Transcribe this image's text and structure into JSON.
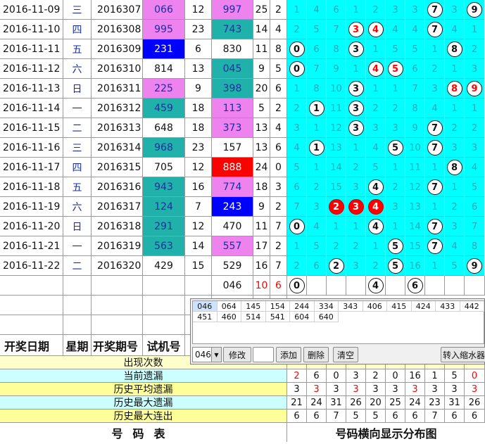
{
  "rows": [
    {
      "date": "2016-11-09",
      "week": "三",
      "issue": "2016307",
      "trial": "066",
      "trial_bg": "pink",
      "tsum": "12",
      "draw": "997",
      "draw_bg": "pink",
      "dsum": "25",
      "span": "2",
      "dist": [
        "1",
        "4",
        "6",
        "1",
        "2",
        "3",
        "3",
        "7",
        "3",
        "9"
      ],
      "balls": {
        "7": "w",
        "9": "w"
      }
    },
    {
      "date": "2016-11-10",
      "week": "四",
      "issue": "2016308",
      "trial": "995",
      "trial_bg": "pink",
      "tsum": "23",
      "draw": "743",
      "draw_bg": "teal",
      "dsum": "14",
      "span": "4",
      "dist": [
        "2",
        "5",
        "7",
        "3",
        "4",
        "4",
        "4",
        "7",
        "4",
        "1"
      ],
      "balls": {
        "3": "wr",
        "4": "wr",
        "7": "w"
      }
    },
    {
      "date": "2016-11-11",
      "week": "五",
      "issue": "2016309",
      "trial": "231",
      "trial_bg": "blue",
      "tsum": "6",
      "draw": "830",
      "draw_bg": "white",
      "dsum": "11",
      "span": "8",
      "dist": [
        "0",
        "6",
        "8",
        "3",
        "1",
        "5",
        "5",
        "1",
        "8",
        "2"
      ],
      "balls": {
        "0": "w",
        "3": "w",
        "8": "w"
      }
    },
    {
      "date": "2016-11-12",
      "week": "六",
      "issue": "2016310",
      "trial": "814",
      "trial_bg": "white",
      "tsum": "13",
      "draw": "045",
      "draw_bg": "teal",
      "dsum": "9",
      "span": "5",
      "dist": [
        "0",
        "7",
        "9",
        "1",
        "4",
        "5",
        "6",
        "2",
        "1",
        "3"
      ],
      "balls": {
        "0": "w",
        "4": "wr",
        "5": "wr"
      }
    },
    {
      "date": "2016-11-13",
      "week": "日",
      "issue": "2016311",
      "trial": "225",
      "trial_bg": "pink",
      "tsum": "9",
      "draw": "398",
      "draw_bg": "teal",
      "dsum": "20",
      "span": "6",
      "dist": [
        "1",
        "8",
        "10",
        "3",
        "1",
        "1",
        "7",
        "3",
        "8",
        "9"
      ],
      "balls": {
        "3": "w",
        "8": "wr",
        "9": "wr"
      }
    },
    {
      "date": "2016-11-14",
      "week": "一",
      "issue": "2016312",
      "trial": "459",
      "trial_bg": "teal",
      "tsum": "18",
      "draw": "113",
      "draw_bg": "pink",
      "dsum": "5",
      "span": "2",
      "dist": [
        "2",
        "1",
        "11",
        "3",
        "2",
        "2",
        "8",
        "4",
        "1",
        "1"
      ],
      "balls": {
        "1": "w",
        "3": "w"
      }
    },
    {
      "date": "2016-11-15",
      "week": "二",
      "issue": "2016313",
      "trial": "648",
      "trial_bg": "white",
      "tsum": "18",
      "draw": "373",
      "draw_bg": "pink",
      "dsum": "13",
      "span": "4",
      "dist": [
        "3",
        "1",
        "12",
        "3",
        "3",
        "3",
        "9",
        "7",
        "2",
        "2"
      ],
      "balls": {
        "3": "w",
        "7": "w"
      }
    },
    {
      "date": "2016-11-16",
      "week": "三",
      "issue": "2016314",
      "trial": "968",
      "trial_bg": "teal",
      "tsum": "23",
      "draw": "157",
      "draw_bg": "white",
      "dsum": "13",
      "span": "6",
      "dist": [
        "4",
        "1",
        "13",
        "1",
        "4",
        "5",
        "10",
        "7",
        "3",
        "3"
      ],
      "balls": {
        "1": "w",
        "5": "w",
        "7": "w"
      }
    },
    {
      "date": "2016-11-17",
      "week": "四",
      "issue": "2016315",
      "trial": "705",
      "trial_bg": "white",
      "tsum": "12",
      "draw": "888",
      "draw_bg": "red",
      "dsum": "24",
      "span": "0",
      "dist": [
        "5",
        "1",
        "14",
        "2",
        "5",
        "1",
        "11",
        "1",
        "8",
        "4"
      ],
      "balls": {
        "8": "w"
      }
    },
    {
      "date": "2016-11-18",
      "week": "五",
      "issue": "2016316",
      "trial": "943",
      "trial_bg": "teal",
      "tsum": "16",
      "draw": "774",
      "draw_bg": "pink",
      "dsum": "18",
      "span": "3",
      "dist": [
        "6",
        "2",
        "15",
        "3",
        "4",
        "2",
        "12",
        "7",
        "1",
        "5"
      ],
      "balls": {
        "4": "w",
        "7": "w"
      }
    },
    {
      "date": "2016-11-19",
      "week": "六",
      "issue": "2016317",
      "trial": "124",
      "trial_bg": "teal",
      "tsum": "7",
      "draw": "243",
      "draw_bg": "blue",
      "dsum": "9",
      "span": "2",
      "dist": [
        "7",
        "3",
        "2",
        "3",
        "4",
        "3",
        "13",
        "1",
        "2",
        "6"
      ],
      "balls": {
        "2": "r",
        "3": "r",
        "4": "r"
      }
    },
    {
      "date": "2016-11-20",
      "week": "日",
      "issue": "2016318",
      "trial": "291",
      "trial_bg": "teal",
      "tsum": "12",
      "draw": "470",
      "draw_bg": "white",
      "dsum": "11",
      "span": "7",
      "dist": [
        "0",
        "4",
        "1",
        "1",
        "4",
        "1",
        "14",
        "7",
        "3",
        "7"
      ],
      "balls": {
        "0": "w",
        "4": "w",
        "7": "w"
      }
    },
    {
      "date": "2016-11-21",
      "week": "一",
      "issue": "2016319",
      "trial": "563",
      "trial_bg": "teal",
      "tsum": "14",
      "draw": "557",
      "draw_bg": "pink",
      "dsum": "17",
      "span": "2",
      "dist": [
        "1",
        "5",
        "2",
        "2",
        "1",
        "5",
        "15",
        "7",
        "4",
        "8"
      ],
      "balls": {
        "5": "w",
        "7": "w"
      }
    },
    {
      "date": "2016-11-22",
      "week": "二",
      "issue": "2016320",
      "trial": "429",
      "trial_bg": "white",
      "tsum": "15",
      "draw": "529",
      "draw_bg": "white",
      "dsum": "16",
      "span": "7",
      "dist": [
        "2",
        "6",
        "2",
        "3",
        "2",
        "5",
        "16",
        "1",
        "5",
        "9"
      ],
      "balls": {
        "2": "w",
        "5": "w",
        "9": "w"
      }
    }
  ],
  "forecast_row": {
    "draw": "046",
    "dsum": "10",
    "span": "6",
    "dist": [
      "0",
      "",
      "",
      "",
      "4",
      "",
      "6",
      "",
      "",
      ""
    ],
    "balls": {
      "0": "w",
      "4": "w",
      "6": "w"
    }
  },
  "header": {
    "date": "开奖日期",
    "week": "星期",
    "issue": "开奖期号",
    "trial": "试机号",
    "tsum": "试",
    "draw": "",
    "dsum": "",
    "span": ""
  },
  "panel": {
    "combos": [
      "046",
      "064",
      "145",
      "154",
      "244",
      "334",
      "343",
      "406",
      "415",
      "424",
      "433",
      "442",
      "451",
      "460",
      "514",
      "541",
      "604",
      "640"
    ],
    "select_value": "046",
    "btn_modify": "修改",
    "input_value": "",
    "btn_add": "添加",
    "btn_delete": "删除",
    "btn_clear": "清空",
    "btn_transfer": "转入缩水器"
  },
  "stats": [
    {
      "label": "出现次数",
      "values": [
        "",
        "",
        "",
        "",
        "",
        "",
        "",
        "",
        "",
        ""
      ],
      "red": []
    },
    {
      "label": "当前遗漏",
      "values": [
        "2",
        "6",
        "0",
        "3",
        "2",
        "0",
        "16",
        "1",
        "5",
        "0"
      ],
      "red": [
        0,
        9
      ]
    },
    {
      "label": "历史平均遗漏",
      "values": [
        "3",
        "3",
        "3",
        "3",
        "3",
        "3",
        "3",
        "3",
        "3",
        "3"
      ],
      "red": [
        1,
        3,
        6,
        9
      ]
    },
    {
      "label": "历史最大遗漏",
      "values": [
        "21",
        "24",
        "31",
        "26",
        "20",
        "25",
        "24",
        "23",
        "31",
        "26"
      ],
      "red": []
    },
    {
      "label": "历史最大连出",
      "values": [
        "6",
        "6",
        "7",
        "5",
        "5",
        "6",
        "6",
        "7",
        "6",
        "6"
      ],
      "red": []
    }
  ],
  "footer": {
    "left": "号码表",
    "right": "号码横向显示分布图"
  }
}
